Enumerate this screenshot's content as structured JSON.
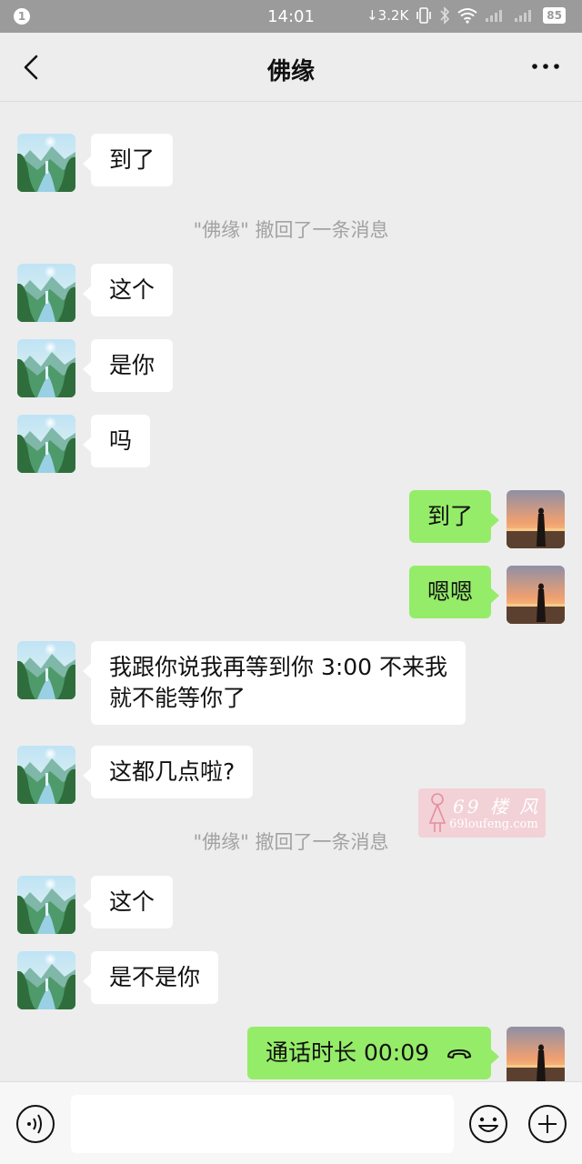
{
  "status_bar": {
    "notification_count": "1",
    "time": "14:01",
    "network_speed": "↓3.2K",
    "battery": "85"
  },
  "header": {
    "title": "佛缘",
    "back_icon": "chevron-left-icon",
    "more_icon": "more-dots-icon"
  },
  "messages": [
    {
      "side": "in",
      "text": "到了"
    },
    {
      "side": "system",
      "text": "\"佛缘\" 撤回了一条消息"
    },
    {
      "side": "in",
      "text": "这个"
    },
    {
      "side": "in",
      "text": "是你"
    },
    {
      "side": "in",
      "text": "吗"
    },
    {
      "side": "out",
      "text": "到了"
    },
    {
      "side": "out",
      "text": "嗯嗯"
    },
    {
      "side": "in",
      "text_line1": "我跟你说我再等到你 3:00 不来我",
      "text_line2": "就不能等你了"
    },
    {
      "side": "in",
      "text": "这都几点啦?"
    },
    {
      "side": "system",
      "text": "\"佛缘\" 撤回了一条消息"
    },
    {
      "side": "in",
      "text": "这个"
    },
    {
      "side": "in",
      "text": "是不是你"
    },
    {
      "side": "out",
      "text": "通话时长 00:09",
      "icon": "phone-hangup-icon"
    }
  ],
  "watermark": {
    "number": "69 楼 风",
    "site": "69loufeng.com"
  },
  "input_bar": {
    "voice_icon": "voice-icon",
    "emoji_icon": "emoji-icon",
    "plus_icon": "plus-icon",
    "placeholder": ""
  },
  "colors": {
    "background": "#ededed",
    "incoming_bubble": "#ffffff",
    "outgoing_bubble": "#95ec69",
    "status_bar": "#9b9b9b",
    "system_text": "#a2a2a2"
  }
}
